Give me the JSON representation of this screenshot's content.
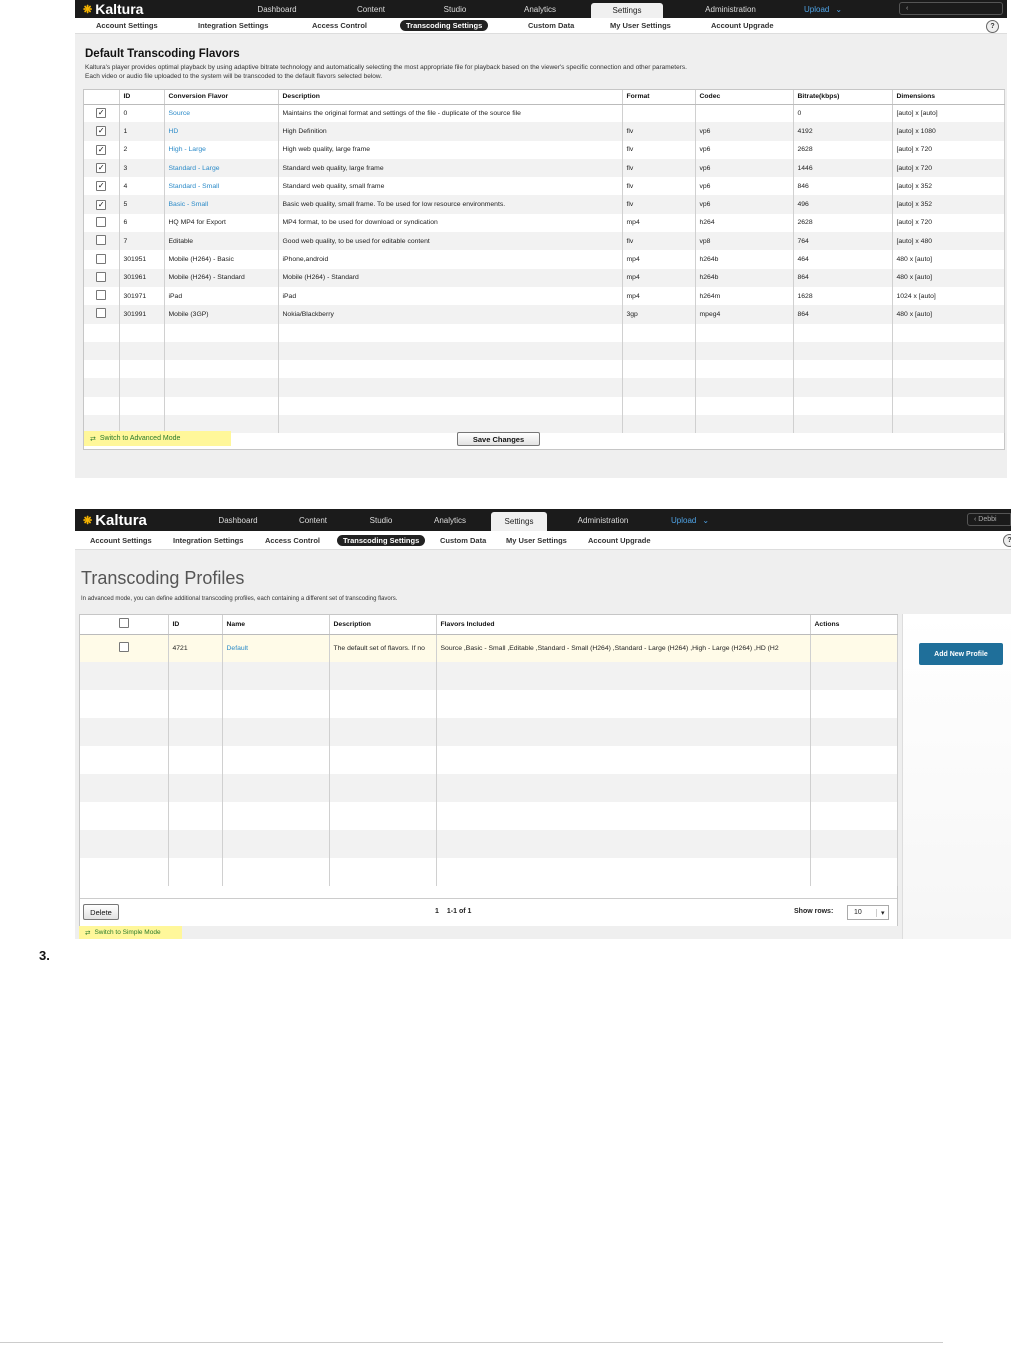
{
  "shot1": {
    "nav": {
      "logo": "Kaltura",
      "items": [
        "Dashboard",
        "Content",
        "Studio",
        "Analytics",
        "Settings",
        "Administration"
      ],
      "upload": "Upload",
      "back": "‹"
    },
    "subnav": [
      "Account Settings",
      "Integration Settings",
      "Access Control",
      "Transcoding Settings",
      "Custom Data",
      "My User Settings",
      "Account Upgrade"
    ],
    "help": "?",
    "title": "Default Transcoding Flavors",
    "intro1": "Kaltura's player provides optimal playback by using adaptive bitrate technology and automatically selecting the most appropriate file for playback based on the viewer's specific connection and other parameters.",
    "intro2": "Each video or audio file uploaded to the system will be transcoded to the default flavors selected below.",
    "columns": [
      "ID",
      "Conversion Flavor",
      "Description",
      "Format",
      "Codec",
      "Bitrate(kbps)",
      "Dimensions"
    ],
    "rows": [
      {
        "checked": true,
        "id": "0",
        "name": "Source",
        "link": true,
        "desc": "Maintains the original format and settings of the file - duplicate of the source file",
        "format": "",
        "codec": "",
        "bitrate": "0",
        "dim": "[auto] x [auto]"
      },
      {
        "checked": true,
        "id": "1",
        "name": "HD",
        "link": true,
        "desc": "High Definition",
        "format": "flv",
        "codec": "vp6",
        "bitrate": "4192",
        "dim": "[auto] x 1080"
      },
      {
        "checked": true,
        "id": "2",
        "name": "High - Large",
        "link": true,
        "desc": "High web quality, large frame",
        "format": "flv",
        "codec": "vp6",
        "bitrate": "2628",
        "dim": "[auto] x 720"
      },
      {
        "checked": true,
        "id": "3",
        "name": "Standard - Large",
        "link": true,
        "desc": "Standard web quality, large frame",
        "format": "flv",
        "codec": "vp6",
        "bitrate": "1446",
        "dim": "[auto] x 720"
      },
      {
        "checked": true,
        "id": "4",
        "name": "Standard - Small",
        "link": true,
        "desc": "Standard web quality, small frame",
        "format": "flv",
        "codec": "vp6",
        "bitrate": "846",
        "dim": "[auto] x 352"
      },
      {
        "checked": true,
        "id": "5",
        "name": "Basic - Small",
        "link": true,
        "desc": "Basic web quality, small frame. To be used for low resource environments.",
        "format": "flv",
        "codec": "vp6",
        "bitrate": "496",
        "dim": "[auto] x 352"
      },
      {
        "checked": false,
        "id": "6",
        "name": "HQ MP4 for Export",
        "link": false,
        "desc": "MP4 format, to be used for download or syndication",
        "format": "mp4",
        "codec": "h264",
        "bitrate": "2628",
        "dim": "[auto] x 720"
      },
      {
        "checked": false,
        "id": "7",
        "name": "Editable",
        "link": false,
        "desc": "Good web quality, to be used for editable content",
        "format": "flv",
        "codec": "vp8",
        "bitrate": "764",
        "dim": "[auto] x 480"
      },
      {
        "checked": false,
        "id": "301951",
        "name": "Mobile (H264) - Basic",
        "link": false,
        "desc": "iPhone,android",
        "format": "mp4",
        "codec": "h264b",
        "bitrate": "464",
        "dim": "480 x [auto]"
      },
      {
        "checked": false,
        "id": "301961",
        "name": "Mobile (H264) - Standard",
        "link": false,
        "desc": "Mobile (H264) - Standard",
        "format": "mp4",
        "codec": "h264b",
        "bitrate": "864",
        "dim": "480 x [auto]"
      },
      {
        "checked": false,
        "id": "301971",
        "name": "iPad",
        "link": false,
        "desc": "iPad",
        "format": "mp4",
        "codec": "h264m",
        "bitrate": "1628",
        "dim": "1024 x [auto]"
      },
      {
        "checked": false,
        "id": "301991",
        "name": "Mobile (3GP)",
        "link": false,
        "desc": "Nokia/Blackberry",
        "format": "3gp",
        "codec": "mpeg4",
        "bitrate": "864",
        "dim": "480 x [auto]"
      }
    ],
    "switch_mode": "Switch to Advanced Mode",
    "save": "Save Changes"
  },
  "shot2": {
    "nav": {
      "logo": "Kaltura",
      "items": [
        "Dashboard",
        "Content",
        "Studio",
        "Analytics",
        "Settings",
        "Administration"
      ],
      "upload": "Upload",
      "back": "‹ Debbi"
    },
    "subnav": [
      "Account Settings",
      "Integration Settings",
      "Access Control",
      "Transcoding Settings",
      "Custom Data",
      "My User Settings",
      "Account Upgrade"
    ],
    "help": "?",
    "title": "Transcoding Profiles",
    "intro": "In advanced mode, you can define additional transcoding profiles, each containing a different set of transcoding flavors.",
    "columns": [
      "ID",
      "Name",
      "Description",
      "Flavors Included",
      "Actions"
    ],
    "rows": [
      {
        "id": "4721",
        "name": "Default",
        "desc": "The default set of flavors. If no",
        "flavors": "Source ,Basic - Small ,Editable ,Standard - Small (H264) ,Standard - Large (H264) ,High - Large (H264) ,HD (H2"
      }
    ],
    "add_profile": "Add New Profile",
    "delete": "Delete",
    "page": "1",
    "range": "1-1 of 1",
    "show_rows_label": "Show rows:",
    "show_rows_value": "10",
    "switch_mode": "Switch to Simple Mode"
  },
  "step_number": "3.",
  "colors": {
    "topbar": "#1b1b1b",
    "link": "#2a8ac8",
    "highlight": "#fff79a",
    "primary_button": "#1f6f9a"
  }
}
